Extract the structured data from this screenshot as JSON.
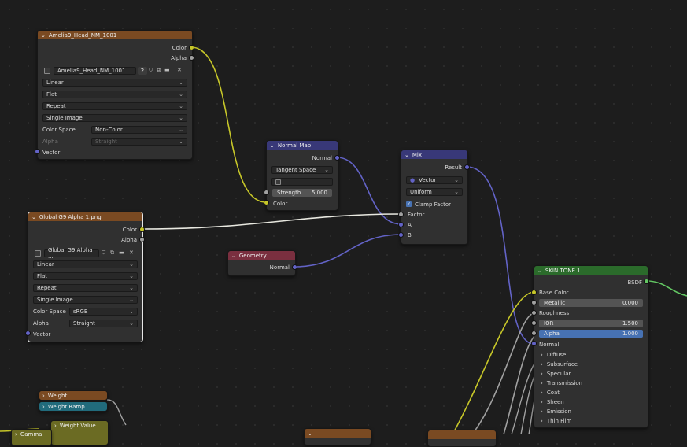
{
  "colors": {
    "color_socket": "#c7c729",
    "float_socket": "#a1a1a1",
    "vector_socket": "#6363c7",
    "shader_socket": "#63c763",
    "texture_header": "#7a4a22",
    "vector_header": "#383878",
    "input_header": "#7a2f3f",
    "shader_header": "#2b6b2b",
    "converter_header": "#216b7c"
  },
  "tex1": {
    "title": "Amelia9_Head_NM_1001",
    "out_color": "Color",
    "out_alpha": "Alpha",
    "image_name": "Amelia9_Head_NM_1001",
    "users": "2",
    "interp": "Linear",
    "proj": "Flat",
    "ext": "Repeat",
    "source": "Single Image",
    "cs_label": "Color Space",
    "cs_value": "Non-Color",
    "alpha_label": "Alpha",
    "alpha_value": "Straight",
    "in_vector": "Vector"
  },
  "normal_map": {
    "title": "Normal Map",
    "out": "Normal",
    "space": "Tangent Space",
    "strength_label": "Strength",
    "strength_value": "5.000",
    "in_color": "Color"
  },
  "mix": {
    "title": "Mix",
    "out": "Result",
    "type": "Vector",
    "mode": "Uniform",
    "clamp": "Clamp Factor",
    "factor": "Factor",
    "a": "A",
    "b": "B"
  },
  "tex2": {
    "title": "Global G9 Alpha 1.png",
    "out_color": "Color",
    "out_alpha": "Alpha",
    "image_name": "Global G9 Alpha ...",
    "interp": "Linear",
    "proj": "Flat",
    "ext": "Repeat",
    "source": "Single Image",
    "cs_label": "Color Space",
    "cs_value": "sRGB",
    "alpha_label": "Alpha",
    "alpha_value": "Straight",
    "in_vector": "Vector"
  },
  "geometry": {
    "title": "Geometry",
    "out": "Normal"
  },
  "bsdf": {
    "title": "SKIN TONE 1",
    "out": "BSDF",
    "base_color": "Base Color",
    "metallic_label": "Metallic",
    "metallic_value": "0.000",
    "roughness": "Roughness",
    "ior_label": "IOR",
    "ior_value": "1.500",
    "alpha_label": "Alpha",
    "alpha_value": "1.000",
    "normal": "Normal",
    "panels": [
      "Diffuse",
      "Subsurface",
      "Specular",
      "Transmission",
      "Coat",
      "Sheen",
      "Emission",
      "Thin Film"
    ]
  },
  "bottom": {
    "weight": "Weight",
    "weight_ramp": "Weight Ramp",
    "weight_value": "Weight Value",
    "gamma": "Gamma"
  }
}
